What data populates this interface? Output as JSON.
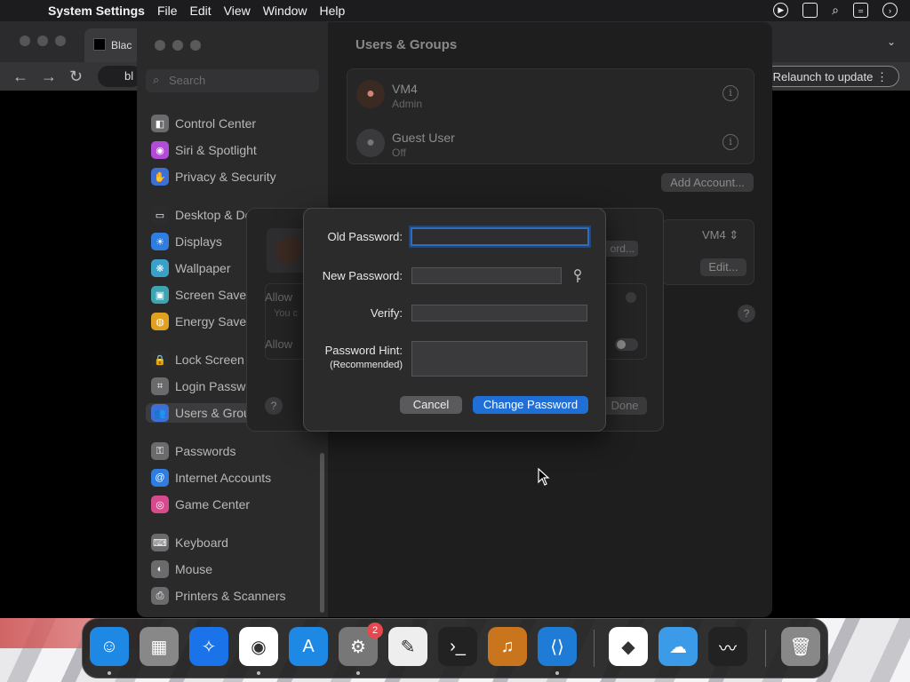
{
  "menubar": {
    "app_name": "System Settings",
    "items": [
      "File",
      "Edit",
      "View",
      "Window",
      "Help"
    ]
  },
  "browser": {
    "tab_title": "Blac",
    "url_fragment": "bl",
    "relaunch_label": "Relaunch to update"
  },
  "settings": {
    "search_placeholder": "Search",
    "sidebar_items": [
      {
        "label": "Control Center",
        "icon": "control-center-icon",
        "color": "#6b6b6e"
      },
      {
        "label": "Siri & Spotlight",
        "icon": "siri-icon",
        "color": "#b14bd8"
      },
      {
        "label": "Privacy & Security",
        "icon": "privacy-hand-icon",
        "color": "#3d6fd4"
      },
      {
        "label": "Desktop & Dock",
        "icon": "desktop-icon",
        "color": "#2c2c2e"
      },
      {
        "label": "Displays",
        "icon": "displays-icon",
        "color": "#2f7de0"
      },
      {
        "label": "Wallpaper",
        "icon": "wallpaper-icon",
        "color": "#3aa0c8"
      },
      {
        "label": "Screen Saver",
        "icon": "screen-saver-icon",
        "color": "#3fa3b0"
      },
      {
        "label": "Energy Saver",
        "icon": "energy-saver-icon",
        "color": "#e0a020"
      },
      {
        "label": "Lock Screen",
        "icon": "lock-icon",
        "color": "#2c2c2e"
      },
      {
        "label": "Login Password",
        "icon": "login-password-icon",
        "color": "#6b6b6e"
      },
      {
        "label": "Users & Groups",
        "icon": "users-groups-icon",
        "color": "#3d6fd4"
      },
      {
        "label": "Passwords",
        "icon": "passwords-key-icon",
        "color": "#6b6b6e"
      },
      {
        "label": "Internet Accounts",
        "icon": "at-sign-icon",
        "color": "#2f7de0"
      },
      {
        "label": "Game Center",
        "icon": "game-center-icon",
        "color": "#d84a8e"
      },
      {
        "label": "Keyboard",
        "icon": "keyboard-icon",
        "color": "#6b6b6e"
      },
      {
        "label": "Mouse",
        "icon": "mouse-icon",
        "color": "#6b6b6e"
      },
      {
        "label": "Printers & Scanners",
        "icon": "printer-icon",
        "color": "#6b6b6e"
      }
    ],
    "content_title": "Users & Groups",
    "users": [
      {
        "name": "VM4",
        "role": "Admin"
      },
      {
        "name": "Guest User",
        "role": "Off"
      }
    ],
    "add_account_label": "Add Account...",
    "auto_login_user": "VM4",
    "edit_label": "Edit...",
    "help_label": "?"
  },
  "sheet_behind": {
    "change_password_partial": "ord...",
    "allow_label_1": "Allow",
    "allow_sub": "You c",
    "allow_label_2": "Allow",
    "done_label": "Done",
    "help_label": "?"
  },
  "dialog": {
    "old_password_label": "Old Password:",
    "new_password_label": "New Password:",
    "verify_label": "Verify:",
    "hint_label": "Password Hint:",
    "hint_sub": "(Recommended)",
    "old_password_value": "",
    "new_password_value": "",
    "verify_value": "",
    "hint_value": "",
    "cancel_label": "Cancel",
    "change_label": "Change Password",
    "accent": "#1f6fd6"
  },
  "dock": {
    "apps": [
      {
        "name": "Finder",
        "icon": "finder-icon"
      },
      {
        "name": "Launchpad",
        "icon": "launchpad-icon"
      },
      {
        "name": "Safari",
        "icon": "safari-icon"
      },
      {
        "name": "Chrome",
        "icon": "chrome-icon"
      },
      {
        "name": "App Store",
        "icon": "app-store-icon"
      },
      {
        "name": "System Settings",
        "icon": "settings-gear-icon"
      },
      {
        "name": "TextEdit",
        "icon": "textedit-icon"
      },
      {
        "name": "Terminal",
        "icon": "terminal-icon"
      },
      {
        "name": "GarageBand",
        "icon": "guitar-icon"
      },
      {
        "name": "Visual Studio Code",
        "icon": "vscode-icon"
      },
      {
        "name": "Visual Studio",
        "icon": "visual-studio-icon"
      },
      {
        "name": "Weather",
        "icon": "weather-icon"
      },
      {
        "name": "Activity Monitor",
        "icon": "activity-monitor-icon"
      },
      {
        "name": "Trash",
        "icon": "trash-icon"
      }
    ],
    "settings_badge": "2"
  }
}
